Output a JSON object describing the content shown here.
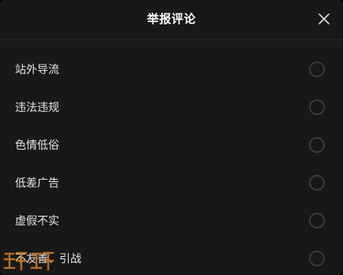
{
  "dialog": {
    "title": "举报评论",
    "close_icon": "close-icon"
  },
  "options": [
    {
      "label": "站外导流",
      "selected": false
    },
    {
      "label": "违法违规",
      "selected": false
    },
    {
      "label": "色情低俗",
      "selected": false
    },
    {
      "label": "低差广告",
      "selected": false
    },
    {
      "label": "虚假不实",
      "selected": false
    },
    {
      "label": "不友善、引战",
      "selected": false
    }
  ],
  "colors": {
    "background": "#181818",
    "text": "#e6e6e6",
    "radio_border": "#3b3b3b",
    "watermark": "#c8782a"
  },
  "watermark": {
    "icon": "watermark-logo"
  }
}
